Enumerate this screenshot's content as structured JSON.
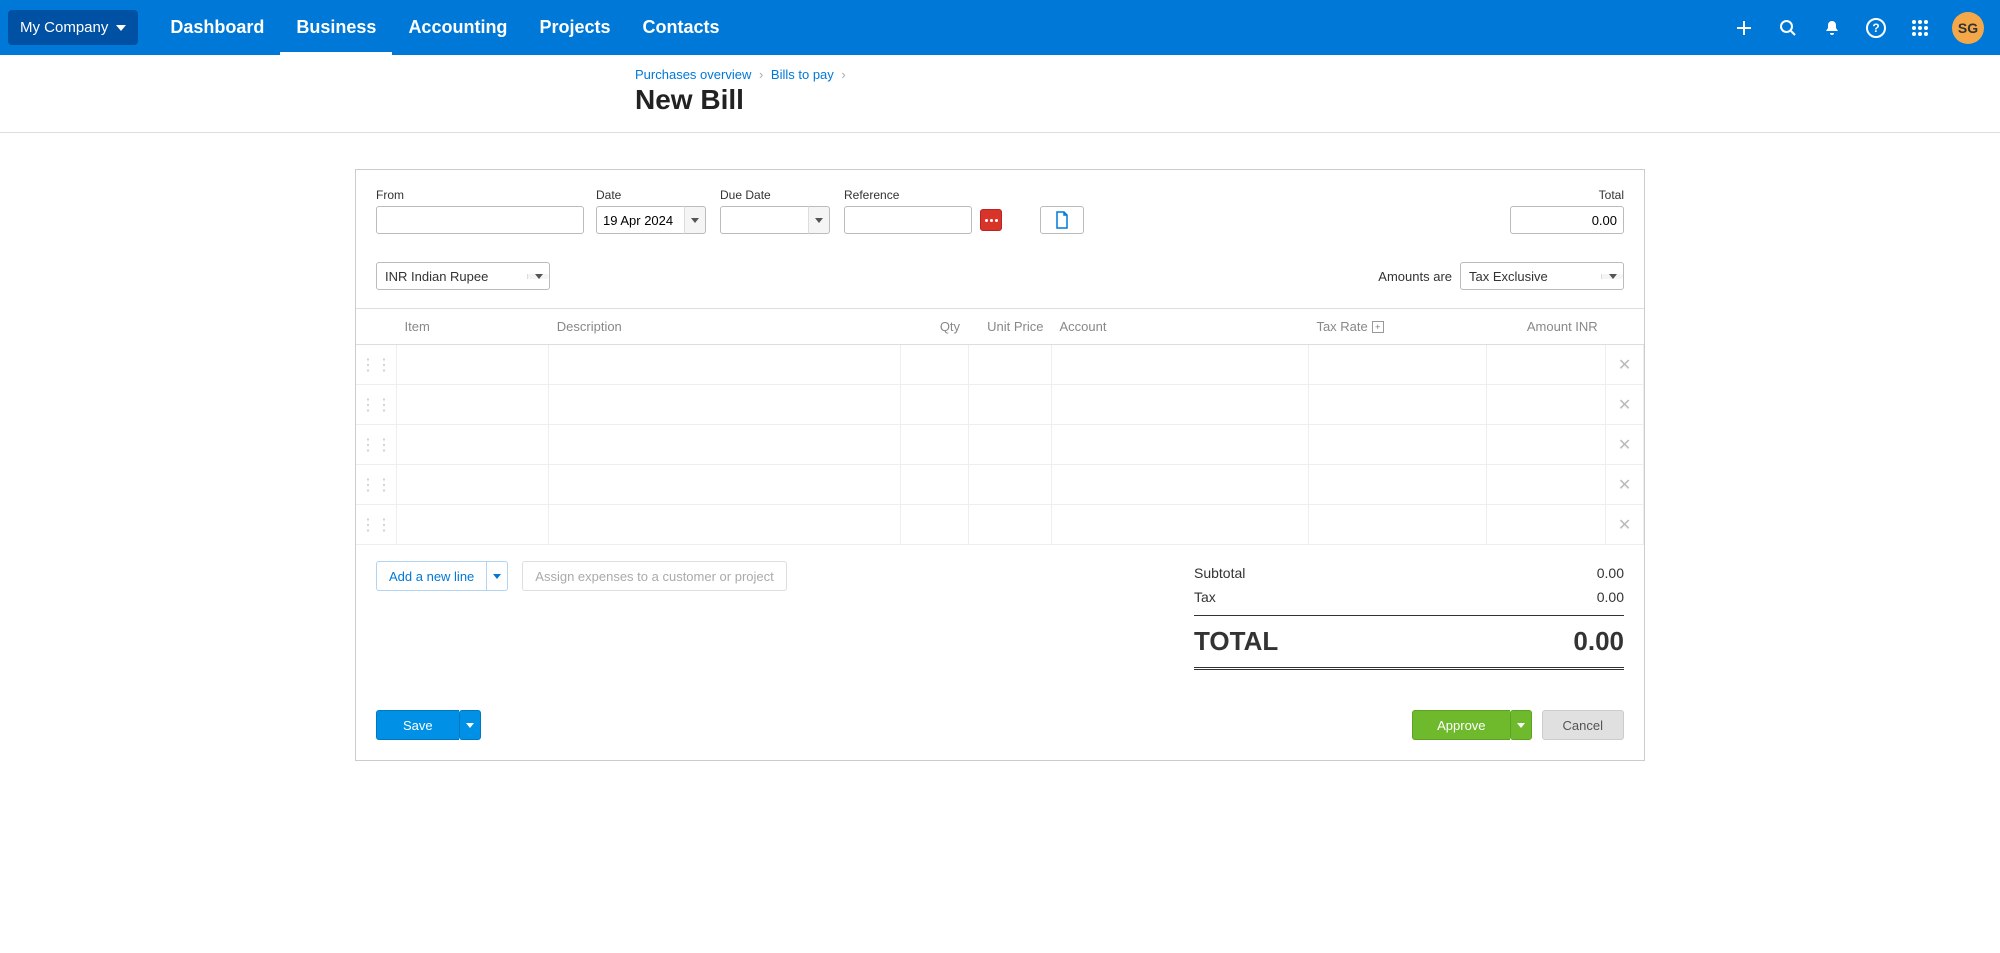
{
  "nav": {
    "org": "My Company",
    "links": [
      "Dashboard",
      "Business",
      "Accounting",
      "Projects",
      "Contacts"
    ],
    "active": 1,
    "avatar": "SG"
  },
  "breadcrumb": {
    "items": [
      "Purchases overview",
      "Bills to pay"
    ],
    "title": "New Bill"
  },
  "form": {
    "from_label": "From",
    "from_value": "",
    "date_label": "Date",
    "date_value": "19 Apr 2024",
    "due_label": "Due Date",
    "due_value": "",
    "ref_label": "Reference",
    "ref_value": "",
    "total_label": "Total",
    "total_value": "0.00",
    "currency": "INR Indian Rupee",
    "amounts_label": "Amounts are",
    "amounts_value": "Tax Exclusive"
  },
  "table": {
    "headers": {
      "item": "Item",
      "desc": "Description",
      "qty": "Qty",
      "price": "Unit Price",
      "account": "Account",
      "tax": "Tax Rate",
      "amount": "Amount INR"
    },
    "rows": 5
  },
  "actions": {
    "add_line": "Add a new line",
    "assign": "Assign expenses to a customer or project"
  },
  "totals": {
    "subtotal_label": "Subtotal",
    "subtotal": "0.00",
    "tax_label": "Tax",
    "tax": "0.00",
    "total_label": "TOTAL",
    "total": "0.00"
  },
  "footer": {
    "save": "Save",
    "approve": "Approve",
    "cancel": "Cancel"
  }
}
